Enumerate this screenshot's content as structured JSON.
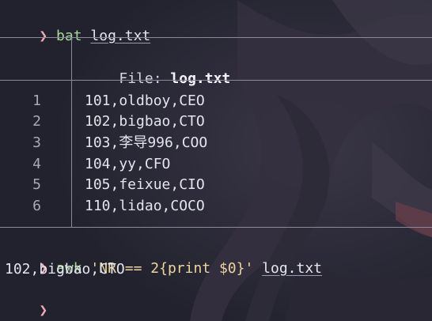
{
  "colors": {
    "background": "#22222e",
    "prompt": "#f0a8b4",
    "command": "#a6da95",
    "string": "#eed49f",
    "text": "#e4e4ee",
    "rule": "#8a8a9c"
  },
  "prompt_symbol": "❯",
  "command1": {
    "name": "bat",
    "arg": "log.txt"
  },
  "bat": {
    "header_label": "File: ",
    "header_file": "log.txt",
    "rows": [
      {
        "num": "1",
        "text": "101,oldboy,CEO"
      },
      {
        "num": "2",
        "text": "102,bigbao,CTO"
      },
      {
        "num": "3",
        "text": "103,李导996,COO"
      },
      {
        "num": "4",
        "text": "104,yy,CFO"
      },
      {
        "num": "5",
        "text": "105,feixue,CIO"
      },
      {
        "num": "6",
        "text": "110,lidao,COCO"
      }
    ]
  },
  "command2": {
    "name": "awk",
    "program": "'NR == 2{print $0}'",
    "arg": "log.txt"
  },
  "output": "102,bigbao,CTO"
}
